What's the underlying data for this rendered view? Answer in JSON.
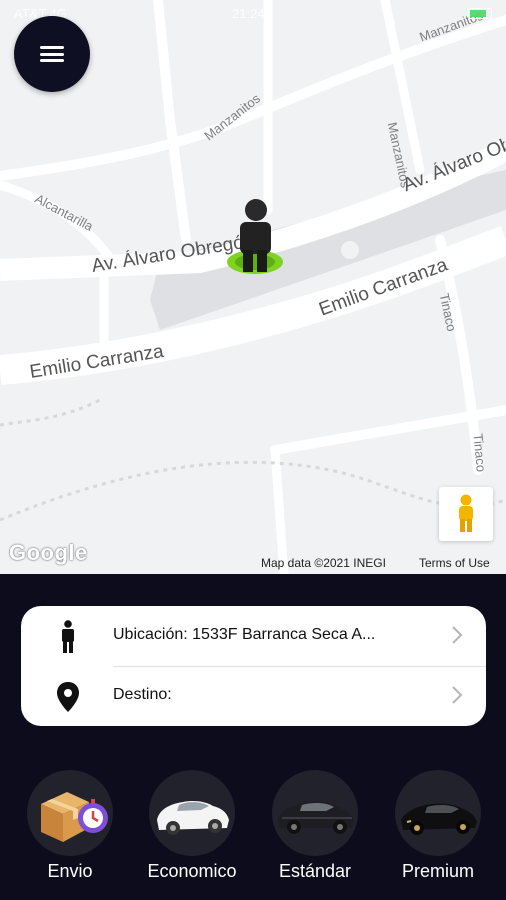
{
  "status_bar": {
    "carrier": "AT&T 4G",
    "time": "21:24"
  },
  "map": {
    "streets": {
      "manzanitos_1": "Manzanitos",
      "manzanitos_2": "Manzanitos",
      "manzanitos_3": "Manzanitos",
      "alcantarilla": "Alcantarilla",
      "alvaro_1": "Av. Álvaro Obregón",
      "alvaro_2": "Av. Álvaro Obregón",
      "emilio_1": "Emilio Carranza",
      "emilio_2": "Emilio Carranza",
      "tinaco_1": "Tinaco",
      "tinaco_2": "Tinaco"
    },
    "google_logo": "Google",
    "map_data": "Map data ©2021 INEGI",
    "terms": "Terms of Use"
  },
  "route": {
    "origin_label": "Ubicación: 1533F Barranca Seca A...",
    "destination_label": "Destino:"
  },
  "services": [
    {
      "label": "Envio"
    },
    {
      "label": "Economico"
    },
    {
      "label": "Estándar"
    },
    {
      "label": "Premium"
    }
  ],
  "colors": {
    "panel_bg": "#0c0c1c",
    "marker_green": "#7ed321",
    "service_circle": "#22222d"
  },
  "icons": {
    "menu": "hamburger-menu-icon",
    "person_marker": "person-marker-icon",
    "pegman": "pegman-icon",
    "origin": "person-icon",
    "destination": "location-pin-icon",
    "chevron": "chevron-right-icon"
  }
}
